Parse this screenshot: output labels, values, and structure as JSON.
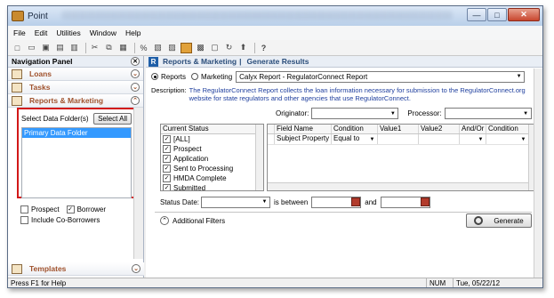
{
  "window": {
    "title": "Point",
    "buttons": {
      "minimize": "—",
      "maximize": "□",
      "close": "✕"
    }
  },
  "menu": [
    "File",
    "Edit",
    "Utilities",
    "Window",
    "Help"
  ],
  "nav": {
    "title": "Navigation Panel",
    "sections": [
      {
        "label": "Loans"
      },
      {
        "label": "Tasks"
      },
      {
        "label": "Reports & Marketing"
      }
    ],
    "select_folders_label": "Select Data Folder(s)",
    "select_all_label": "Select All",
    "folders": [
      "Primary Data Folder"
    ],
    "checks": [
      {
        "label": "Prospect",
        "checked": false
      },
      {
        "label": "Borrower",
        "checked": true
      },
      {
        "label": "Include Co-Borrowers",
        "checked": false
      }
    ],
    "templates_label": "Templates"
  },
  "main": {
    "header_title": "Reports & Marketing",
    "header_link": "Generate Results",
    "radio_reports": "Reports",
    "radio_marketing": "Marketing",
    "report_selected": "Calyx Report - RegulatorConnect Report",
    "description_label": "Description:",
    "description_text": "The RegulatorConnect Report collects the loan information necessary for submission to the RegulatorConnect.org website for state regulators and other agencies that use RegulatorConnect.",
    "originator_label": "Originator:",
    "processor_label": "Processor:",
    "current_status_header": "Current Status",
    "statuses": [
      {
        "label": "[ALL]",
        "checked": true
      },
      {
        "label": "Prospect",
        "checked": true
      },
      {
        "label": "Application",
        "checked": true
      },
      {
        "label": "Sent to Processing",
        "checked": true
      },
      {
        "label": "HMDA Complete",
        "checked": true
      },
      {
        "label": "Submitted",
        "checked": true
      }
    ],
    "filter_columns": [
      "Field Name",
      "Condition",
      "Value1",
      "Value2",
      "And/Or",
      "Condition"
    ],
    "filter_rows": [
      {
        "field": "Subject Property Sta",
        "condition": "Equal to"
      }
    ],
    "status_date_label": "Status Date:",
    "is_between_label": "is between",
    "and_label": "and",
    "advanced_filters_label": "Additional Filters",
    "generate_label": "Generate"
  },
  "statusbar": {
    "help": "Press F1 for Help",
    "num": "NUM",
    "date": "Tue, 05/22/12"
  }
}
